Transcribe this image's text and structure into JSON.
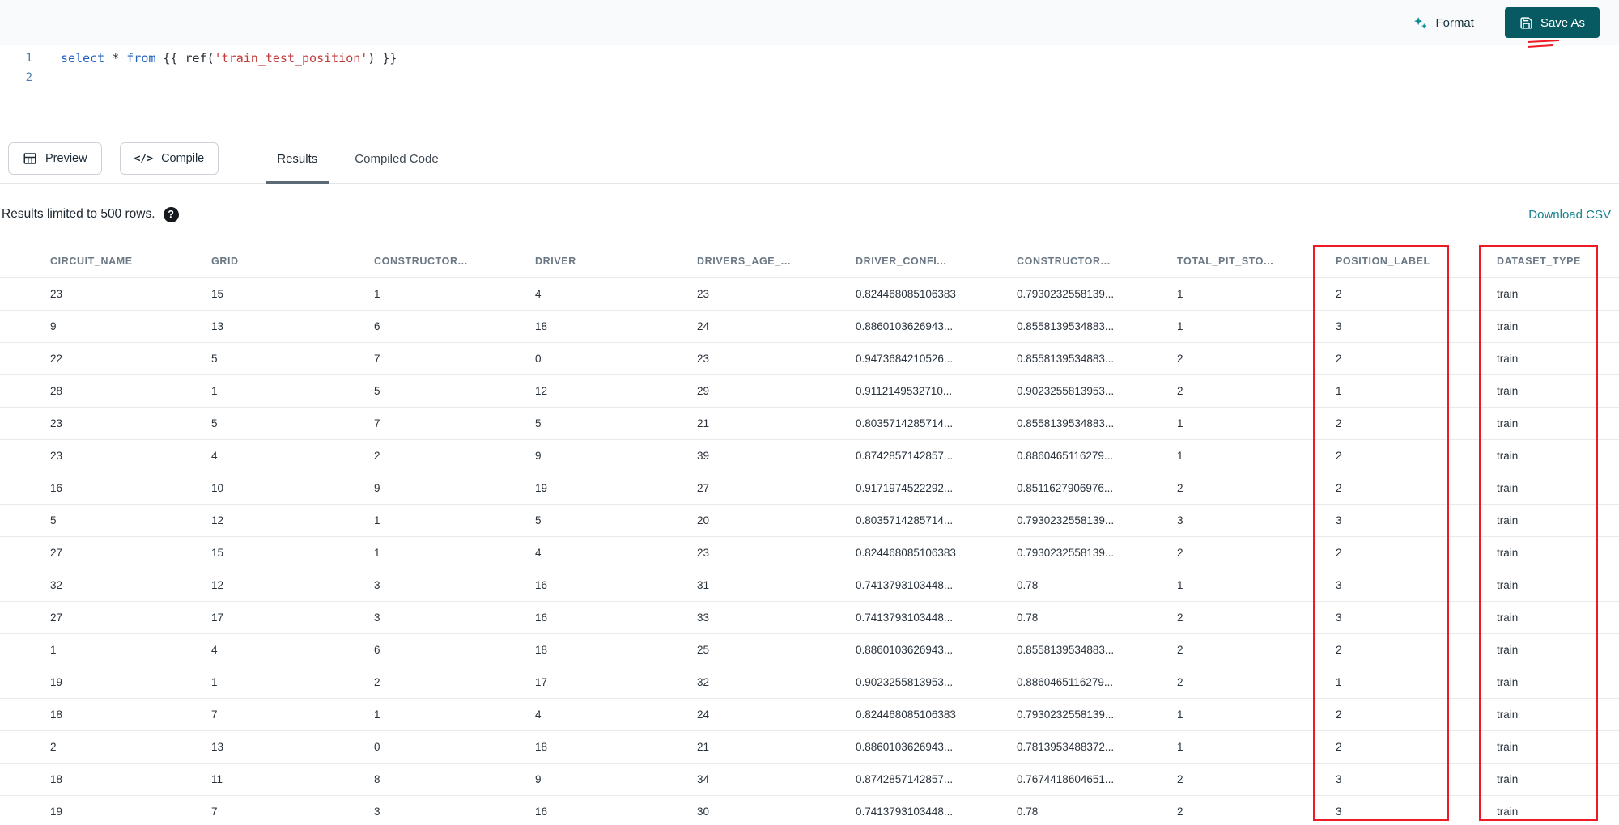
{
  "topbar": {
    "format_label": "Format",
    "save_as_label": "Save As"
  },
  "editor": {
    "line_numbers": [
      "1",
      "2"
    ],
    "code_tokens": [
      {
        "t": "select",
        "c": "kw"
      },
      {
        "t": " * ",
        "c": "plain"
      },
      {
        "t": "from",
        "c": "kw"
      },
      {
        "t": " {{ ",
        "c": "plain"
      },
      {
        "t": "ref(",
        "c": "plain"
      },
      {
        "t": "'train_test_position'",
        "c": "str"
      },
      {
        "t": ") }}",
        "c": "plain"
      }
    ]
  },
  "toolbar": {
    "preview_label": "Preview",
    "compile_label": "Compile",
    "compile_icon_glyph": "</>"
  },
  "tabs": [
    {
      "label": "Results",
      "active": true
    },
    {
      "label": "Compiled Code",
      "active": false
    }
  ],
  "results_bar": {
    "limit_text": "Results limited to 500 rows.",
    "help_icon_glyph": "?",
    "download_label": "Download CSV"
  },
  "table": {
    "columns": [
      "CIRCUIT_NAME",
      "GRID",
      "CONSTRUCTOR...",
      "DRIVER",
      "DRIVERS_AGE_...",
      "DRIVER_CONFI...",
      "CONSTRUCTOR...",
      "TOTAL_PIT_STO...",
      "POSITION_LABEL",
      "DATASET_TYPE"
    ],
    "rows": [
      [
        "23",
        "15",
        "1",
        "4",
        "23",
        "0.824468085106383",
        "0.7930232558139...",
        "1",
        "2",
        "train"
      ],
      [
        "9",
        "13",
        "6",
        "18",
        "24",
        "0.8860103626943...",
        "0.8558139534883...",
        "1",
        "3",
        "train"
      ],
      [
        "22",
        "5",
        "7",
        "0",
        "23",
        "0.9473684210526...",
        "0.8558139534883...",
        "2",
        "2",
        "train"
      ],
      [
        "28",
        "1",
        "5",
        "12",
        "29",
        "0.9112149532710...",
        "0.9023255813953...",
        "2",
        "1",
        "train"
      ],
      [
        "23",
        "5",
        "7",
        "5",
        "21",
        "0.8035714285714...",
        "0.8558139534883...",
        "1",
        "2",
        "train"
      ],
      [
        "23",
        "4",
        "2",
        "9",
        "39",
        "0.8742857142857...",
        "0.8860465116279...",
        "1",
        "2",
        "train"
      ],
      [
        "16",
        "10",
        "9",
        "19",
        "27",
        "0.9171974522292...",
        "0.8511627906976...",
        "2",
        "2",
        "train"
      ],
      [
        "5",
        "12",
        "1",
        "5",
        "20",
        "0.8035714285714...",
        "0.7930232558139...",
        "3",
        "3",
        "train"
      ],
      [
        "27",
        "15",
        "1",
        "4",
        "23",
        "0.824468085106383",
        "0.7930232558139...",
        "2",
        "2",
        "train"
      ],
      [
        "32",
        "12",
        "3",
        "16",
        "31",
        "0.7413793103448...",
        "0.78",
        "1",
        "3",
        "train"
      ],
      [
        "27",
        "17",
        "3",
        "16",
        "33",
        "0.7413793103448...",
        "0.78",
        "2",
        "3",
        "train"
      ],
      [
        "1",
        "4",
        "6",
        "18",
        "25",
        "0.8860103626943...",
        "0.8558139534883...",
        "2",
        "2",
        "train"
      ],
      [
        "19",
        "1",
        "2",
        "17",
        "32",
        "0.9023255813953...",
        "0.8860465116279...",
        "2",
        "1",
        "train"
      ],
      [
        "18",
        "7",
        "1",
        "4",
        "24",
        "0.824468085106383",
        "0.7930232558139...",
        "1",
        "2",
        "train"
      ],
      [
        "2",
        "13",
        "0",
        "18",
        "21",
        "0.8860103626943...",
        "0.7813953488372...",
        "1",
        "2",
        "train"
      ],
      [
        "18",
        "11",
        "8",
        "9",
        "34",
        "0.8742857142857...",
        "0.7674418604651...",
        "2",
        "3",
        "train"
      ],
      [
        "19",
        "7",
        "3",
        "16",
        "30",
        "0.7413793103448...",
        "0.78",
        "2",
        "3",
        "train"
      ]
    ]
  },
  "colors": {
    "accent_teal": "#0d8d96",
    "save_button_teal": "#075a61",
    "link_teal": "#147f8e",
    "annotation_red": "#ed1c24",
    "keyword_blue": "#2563c0",
    "string_red": "#c23b3b"
  }
}
